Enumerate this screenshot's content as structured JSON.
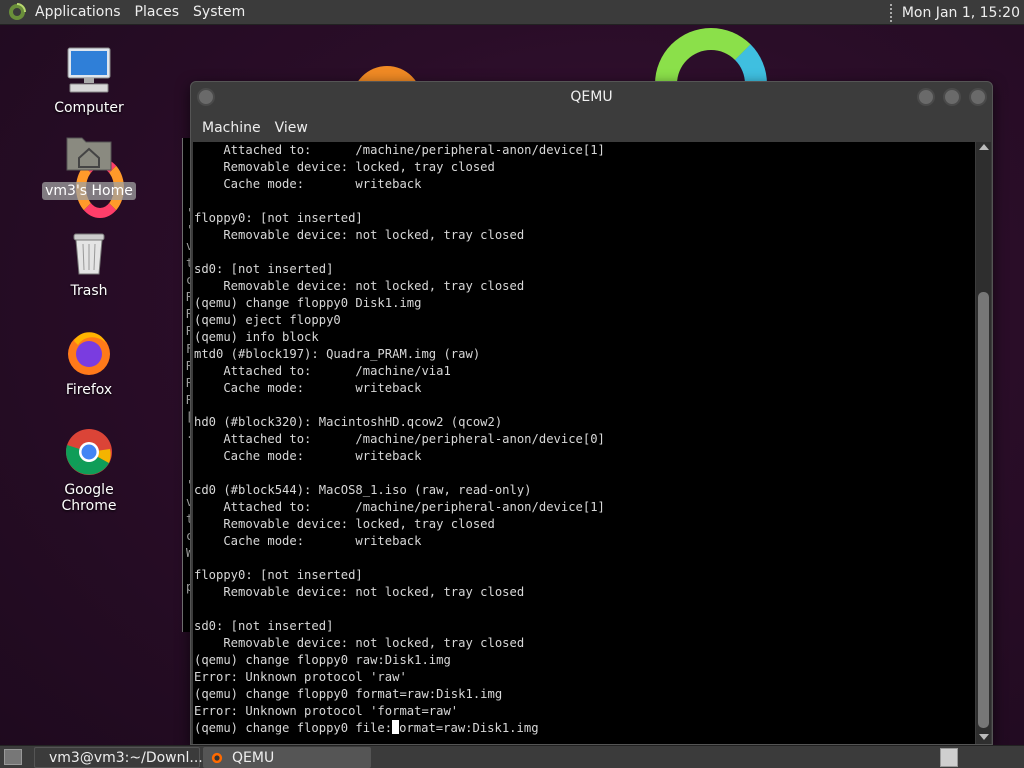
{
  "top_panel": {
    "menus": [
      "Applications",
      "Places",
      "System"
    ],
    "clock": "Mon Jan 1, 15:20"
  },
  "desktop_icons": [
    {
      "label": "Computer",
      "icon": "computer-icon"
    },
    {
      "label": "vm3's Home",
      "icon": "home-folder-icon"
    },
    {
      "label": "Trash",
      "icon": "trash-icon"
    },
    {
      "label": "Firefox",
      "icon": "firefox-icon"
    },
    {
      "label": "Google Chrome",
      "icon": "chrome-icon"
    }
  ],
  "qemu": {
    "title": "QEMU",
    "menus": [
      "Machine",
      "View"
    ],
    "console_lines": [
      "    Attached to:      /machine/peripheral-anon/device[1]",
      "    Removable device: locked, tray closed",
      "    Cache mode:       writeback",
      "",
      "floppy0: [not inserted]",
      "    Removable device: not locked, tray closed",
      "",
      "sd0: [not inserted]",
      "    Removable device: not locked, tray closed",
      "(qemu) change floppy0 Disk1.img",
      "(qemu) eject floppy0",
      "(qemu) info block",
      "mtd0 (#block197): Quadra_PRAM.img (raw)",
      "    Attached to:      /machine/via1",
      "    Cache mode:       writeback",
      "",
      "hd0 (#block320): MacintoshHD.qcow2 (qcow2)",
      "    Attached to:      /machine/peripheral-anon/device[0]",
      "    Cache mode:       writeback",
      "",
      "cd0 (#block544): MacOS8_1.iso (raw, read-only)",
      "    Attached to:      /machine/peripheral-anon/device[1]",
      "    Removable device: locked, tray closed",
      "    Cache mode:       writeback",
      "",
      "floppy0: [not inserted]",
      "    Removable device: not locked, tray closed",
      "",
      "sd0: [not inserted]",
      "    Removable device: not locked, tray closed",
      "(qemu) change floppy0 raw:Disk1.img",
      "Error: Unknown protocol 'raw'",
      "(qemu) change floppy0 format=raw:Disk1.img",
      "Error: Unknown protocol 'format=raw'"
    ],
    "prompt_prefix": "(qemu) change floppy0 file:",
    "prompt_after_cursor": "ormat=raw:Disk1.img"
  },
  "background_fragments": [
    "'",
    "'",
    "v",
    "t",
    "c",
    "R",
    "R",
    "R",
    "F",
    "R",
    "R",
    "R",
    "[",
    ".",
    "'",
    "v",
    "t",
    "c",
    "W",
    "p"
  ],
  "taskbar": {
    "tasks": [
      {
        "label": "vm3@vm3:~/Downl...",
        "icon": "terminal-icon"
      },
      {
        "label": "QEMU",
        "icon": "qemu-icon"
      }
    ]
  }
}
